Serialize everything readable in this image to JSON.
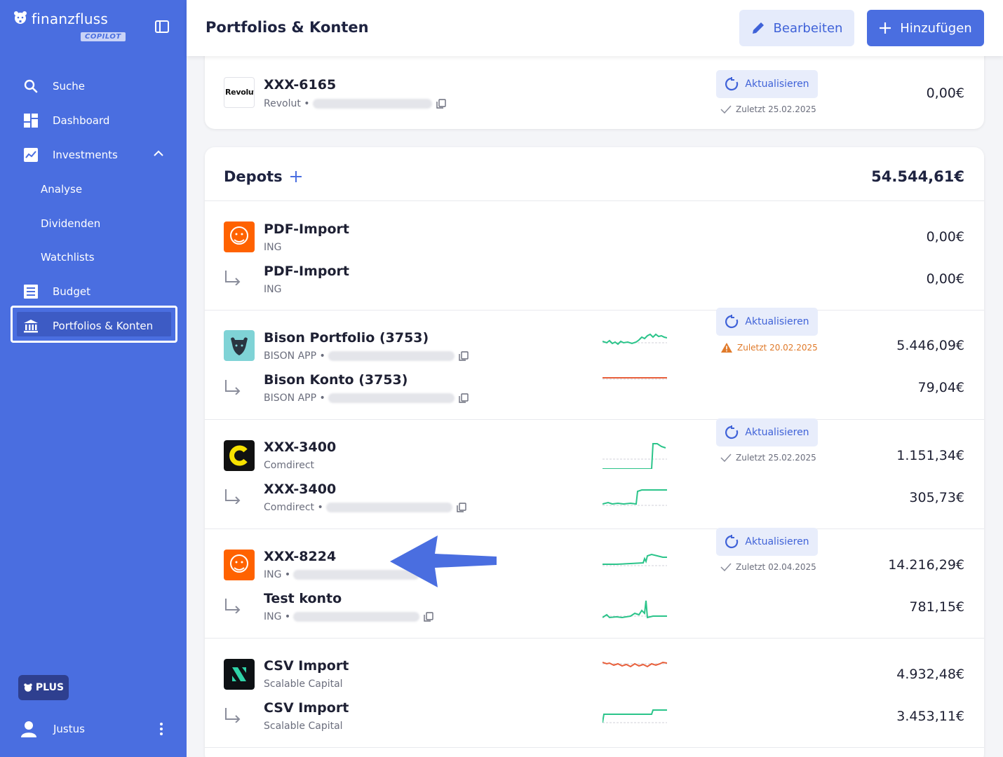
{
  "sidebar": {
    "brand": "finanzfluss",
    "brand_badge": "COPILOT",
    "items": [
      {
        "label": "Suche",
        "icon": "search-icon"
      },
      {
        "label": "Dashboard",
        "icon": "dashboard-icon"
      },
      {
        "label": "Investments",
        "icon": "trending-up-icon"
      },
      {
        "label": "Analyse"
      },
      {
        "label": "Dividenden"
      },
      {
        "label": "Watchlists"
      },
      {
        "label": "Budget",
        "icon": "list-icon"
      },
      {
        "label": "Portfolios & Konten",
        "icon": "bank-icon",
        "active": true
      }
    ],
    "plan_badge": "PLUS",
    "user_name": "Justus"
  },
  "header": {
    "title": "Portfolios & Konten",
    "edit_label": "Bearbeiten",
    "add_label": "Hinzufügen"
  },
  "top_account": {
    "title": "XXX-6165",
    "provider": "Revolut •",
    "logo_text": "Revolut",
    "refresh_label": "Aktualisieren",
    "last_sync": "Zuletzt 25.02.2025",
    "amount": "0,00€"
  },
  "depots": {
    "title": "Depots",
    "total": "54.544,61€",
    "groups": [
      {
        "accounts": [
          {
            "title": "PDF-Import",
            "provider": "ING",
            "amount": "0,00€"
          },
          {
            "title": "PDF-Import",
            "provider": "ING",
            "amount": "0,00€"
          }
        ]
      },
      {
        "refresh_label": "Aktualisieren",
        "last_sync": "Zuletzt 20.02.2025",
        "sync_status": "warning",
        "accounts": [
          {
            "title": "Bison Portfolio (3753)",
            "provider": "BISON APP •",
            "amount": "5.446,09€"
          },
          {
            "title": "Bison Konto (3753)",
            "provider": "BISON APP •",
            "amount": "79,04€"
          }
        ]
      },
      {
        "refresh_label": "Aktualisieren",
        "last_sync": "Zuletzt 25.02.2025",
        "sync_status": "ok",
        "accounts": [
          {
            "title": "XXX-3400",
            "provider": "Comdirect",
            "amount": "1.151,34€"
          },
          {
            "title": "XXX-3400",
            "provider": "Comdirect •",
            "amount": "305,73€"
          }
        ]
      },
      {
        "refresh_label": "Aktualisieren",
        "last_sync": "Zuletzt 02.04.2025",
        "sync_status": "ok",
        "accounts": [
          {
            "title": "XXX-8224",
            "provider": "ING •",
            "amount": "14.216,29€"
          },
          {
            "title": "Test konto",
            "provider": "ING •",
            "amount": "781,15€"
          }
        ]
      },
      {
        "accounts": [
          {
            "title": "CSV Import",
            "provider": "Scalable Capital",
            "amount": "4.932,48€"
          },
          {
            "title": "CSV Import",
            "provider": "Scalable Capital",
            "amount": "3.453,11€"
          }
        ]
      }
    ]
  },
  "colors": {
    "sidebar": "#4a6ee0",
    "accent": "#3f62d8",
    "positive": "#2bc48a",
    "negative": "#e8603c",
    "warning": "#e07a2a"
  }
}
